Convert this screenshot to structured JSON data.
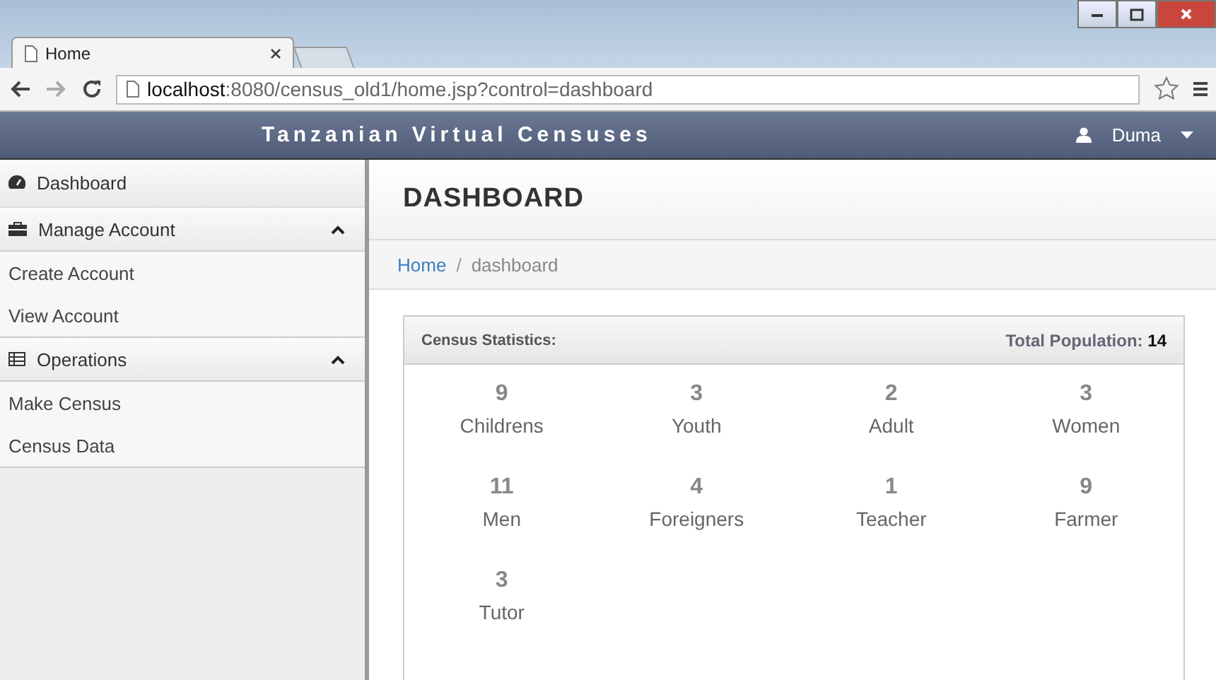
{
  "browser": {
    "tab_title": "Home",
    "url_host": "localhost",
    "url_rest": ":8080/census_old1/home.jsp?control=dashboard"
  },
  "navbar": {
    "title": "Tanzanian Virtual Censuses",
    "user": "Duma"
  },
  "sidebar": {
    "items": [
      {
        "kind": "link",
        "label": "Dashboard"
      },
      {
        "kind": "group",
        "label": "Manage Account",
        "expanded": true
      },
      {
        "kind": "sub",
        "label": "Create Account"
      },
      {
        "kind": "sub",
        "label": "View Account"
      },
      {
        "kind": "group",
        "label": "Operations",
        "expanded": true
      },
      {
        "kind": "sub",
        "label": "Make Census"
      },
      {
        "kind": "sub",
        "label": "Census Data"
      }
    ]
  },
  "page": {
    "title": "DASHBOARD",
    "breadcrumb": [
      "Home",
      "dashboard"
    ],
    "breadcrumb_separator": "/"
  },
  "panel": {
    "title": "Census Statistics:",
    "total_label": "Total Population:",
    "total_value": "14",
    "stats": [
      {
        "value": "9",
        "label": "Childrens"
      },
      {
        "value": "3",
        "label": "Youth"
      },
      {
        "value": "2",
        "label": "Adult"
      },
      {
        "value": "3",
        "label": "Women"
      },
      {
        "value": "11",
        "label": "Men"
      },
      {
        "value": "4",
        "label": "Foreigners"
      },
      {
        "value": "1",
        "label": "Teacher"
      },
      {
        "value": "9",
        "label": "Farmer"
      },
      {
        "value": "3",
        "label": "Tutor"
      }
    ]
  }
}
